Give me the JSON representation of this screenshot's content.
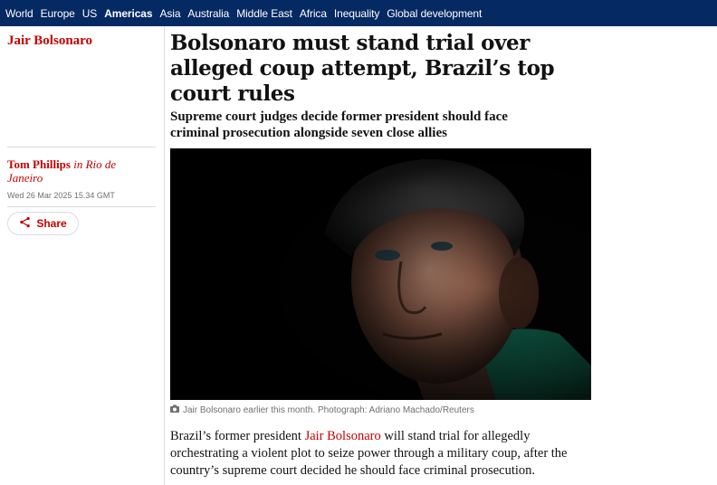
{
  "nav": {
    "items": [
      {
        "label": "World",
        "active": false
      },
      {
        "label": "Europe",
        "active": false
      },
      {
        "label": "US",
        "active": false
      },
      {
        "label": "Americas",
        "active": true
      },
      {
        "label": "Asia",
        "active": false
      },
      {
        "label": "Australia",
        "active": false
      },
      {
        "label": "Middle East",
        "active": false
      },
      {
        "label": "Africa",
        "active": false
      },
      {
        "label": "Inequality",
        "active": false
      },
      {
        "label": "Global development",
        "active": false
      }
    ]
  },
  "section": {
    "title": "Jair Bolsonaro"
  },
  "byline": {
    "author": "Tom Phillips",
    "location": "in Rio de Janeiro"
  },
  "dateline": "Wed 26 Mar 2025 15.34 GMT",
  "share": {
    "label": "Share",
    "icon": "share-icon"
  },
  "article": {
    "headline": "Bolsonaro must stand trial over alleged coup attempt, Brazil’s top court rules",
    "standfirst": "Supreme court judges decide former president should face criminal prosecution alongside seven close allies",
    "caption": "Jair Bolsonaro earlier this month. Photograph: Adriano Machado/Reuters",
    "body": {
      "before_link": "Brazil’s former president ",
      "link": "Jair Bolsonaro",
      "after_link": " will stand trial for allegedly orchestrating a violent plot to seize power through a military coup, after the country’s supreme court decided he should face criminal prosecution."
    }
  },
  "colors": {
    "nav_bg": "#052962",
    "accent": "#c70000",
    "meta": "#707070"
  }
}
